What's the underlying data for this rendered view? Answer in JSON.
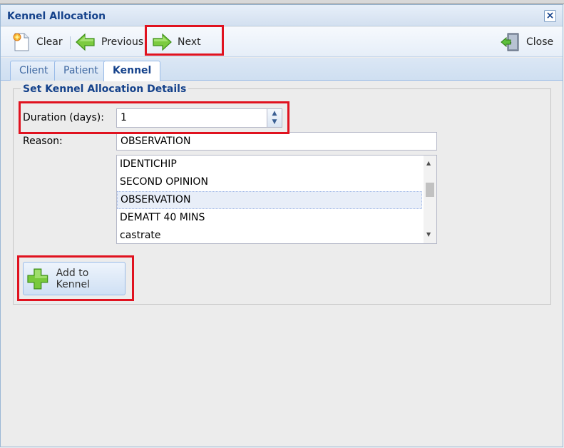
{
  "window": {
    "title": "Kennel Allocation"
  },
  "toolbar": {
    "clear_label": "Clear",
    "previous_label": "Previous",
    "next_label": "Next",
    "close_label": "Close"
  },
  "tabs": [
    {
      "label": "Client"
    },
    {
      "label": "Patient"
    },
    {
      "label": "Kennel",
      "active": true
    }
  ],
  "form": {
    "legend": "Set Kennel Allocation Details",
    "duration_label": "Duration (days):",
    "duration_value": "1",
    "reason_label": "Reason:",
    "reason_value": "OBSERVATION",
    "reason_options": [
      {
        "label": "IDENTICHIP"
      },
      {
        "label": "SECOND OPINION"
      },
      {
        "label": "OBSERVATION",
        "selected": true
      },
      {
        "label": "DEMATT 40 MINS"
      },
      {
        "label": "castrate"
      }
    ],
    "add_button_label": "Add to Kennel"
  },
  "colors": {
    "highlight": "#e0121f",
    "title": "#15428b",
    "selected_row": "#e8eef8"
  }
}
